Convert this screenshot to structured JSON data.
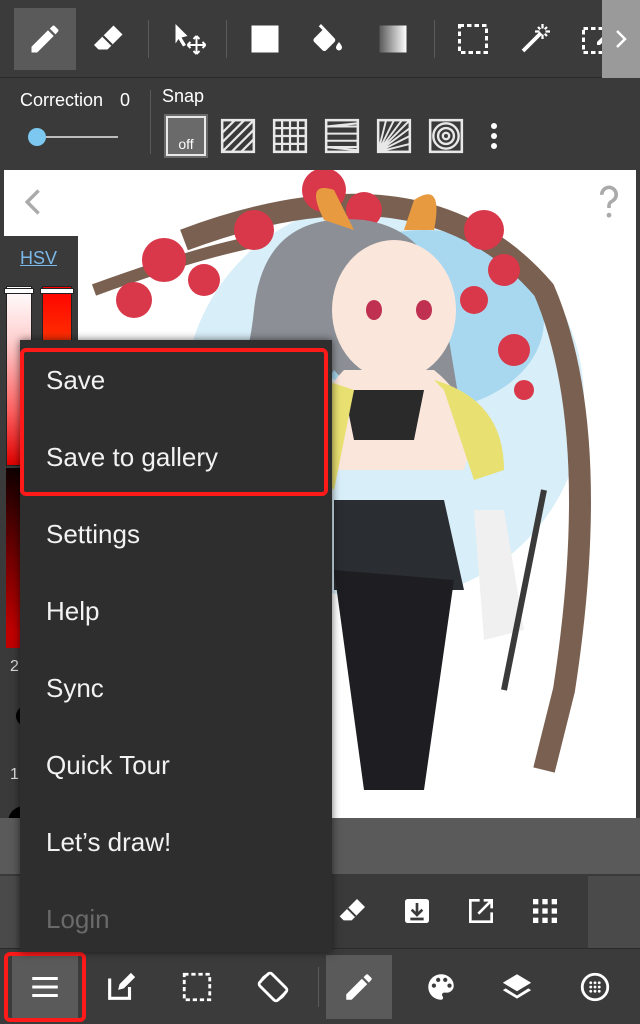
{
  "toolbar": {
    "tools": [
      {
        "name": "pen-tool",
        "icon": "pencil-icon",
        "active": true
      },
      {
        "name": "eraser-tool",
        "icon": "eraser-icon",
        "active": false
      },
      {
        "name": "move-tool",
        "icon": "move-cursor-icon",
        "active": false
      },
      {
        "name": "fill-rect-tool",
        "icon": "filled-square-icon",
        "active": false
      },
      {
        "name": "bucket-tool",
        "icon": "paint-bucket-icon",
        "active": false
      },
      {
        "name": "gradient-tool",
        "icon": "gradient-icon",
        "active": false
      },
      {
        "name": "select-tool",
        "icon": "marquee-icon",
        "active": false
      },
      {
        "name": "magic-wand-tool",
        "icon": "magic-wand-icon",
        "active": false
      },
      {
        "name": "select-pen-tool",
        "icon": "select-pen-icon",
        "active": false
      }
    ],
    "scroll_icon": "chevron-right-icon"
  },
  "options": {
    "correction_label": "Correction",
    "correction_value": "0",
    "correction_level": 0,
    "snap_label": "Snap",
    "snap_off_text": "off",
    "snap_modes": [
      "parallel-snap-icon",
      "grid-snap-icon",
      "perspective-snap-icon",
      "radial-snap-icon",
      "concentric-snap-icon"
    ]
  },
  "color_panel": {
    "mode_label": "HSV",
    "value_a": "2",
    "value_b": "1"
  },
  "menu": {
    "items": [
      {
        "label": "Save",
        "enabled": true
      },
      {
        "label": "Save to gallery",
        "enabled": true
      },
      {
        "label": "Settings",
        "enabled": true
      },
      {
        "label": "Help",
        "enabled": true
      },
      {
        "label": "Sync",
        "enabled": true
      },
      {
        "label": "Quick Tour",
        "enabled": true
      },
      {
        "label": "Let’s draw!",
        "enabled": true
      },
      {
        "label": "Login",
        "enabled": false
      }
    ]
  },
  "quick_toolbar": [
    "eraser-icon",
    "import-icon",
    "share-icon",
    "grid-dots-icon"
  ],
  "bottom_toolbar": [
    "menu-icon",
    "edit-icon",
    "selection-icon",
    "rotate-icon",
    "pencil-icon",
    "palette-icon",
    "layers-icon",
    "brush-size-icon"
  ],
  "colors": {
    "highlight": "#ff1a1a",
    "slider_thumb": "#7cc8f0",
    "hsv_link": "#7ab8e8"
  }
}
